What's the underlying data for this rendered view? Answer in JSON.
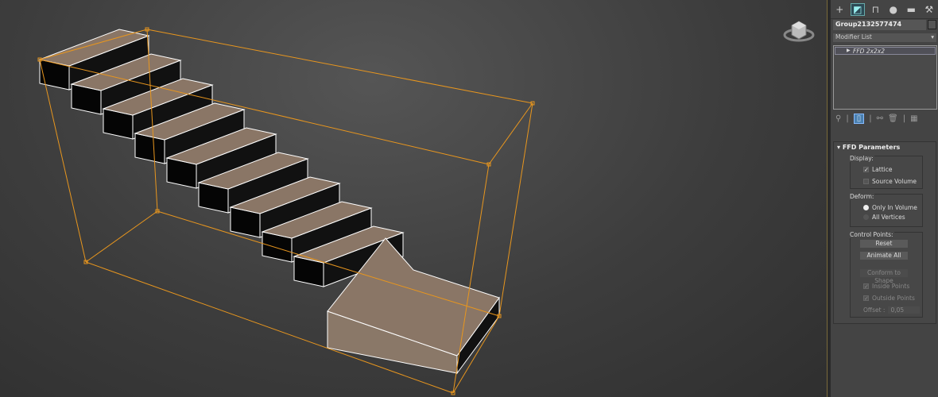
{
  "command_panel": {
    "tabs": [
      {
        "name": "create",
        "glyph": "+"
      },
      {
        "name": "modify",
        "glyph": "◩"
      },
      {
        "name": "hierarchy",
        "glyph": "⊓"
      },
      {
        "name": "motion",
        "glyph": "●"
      },
      {
        "name": "display",
        "glyph": "▬"
      },
      {
        "name": "utilities",
        "glyph": "⚒"
      }
    ],
    "object_name": "Group2132577474",
    "modifier_list": "Modifier List",
    "stack": [
      {
        "label": "FFD 2x2x2"
      }
    ],
    "rollout": {
      "title": "FFD Parameters",
      "display": {
        "label": "Display:",
        "lattice": "Lattice",
        "lattice_checked": true,
        "source_volume": "Source Volume",
        "source_volume_checked": false
      },
      "deform": {
        "label": "Deform:",
        "only_in_volume": "Only In Volume",
        "all_vertices": "All Vertices",
        "selected": "only_in_volume"
      },
      "control_points": {
        "label": "Control Points:",
        "reset": "Reset",
        "animate_all": "Animate All",
        "conform": "Conform to Shape",
        "inside_points": "Inside Points",
        "outside_points": "Outside Points",
        "offset_label": "Offset :",
        "offset_value": "0,05"
      }
    }
  },
  "colors": {
    "lattice": "#e8961e",
    "step_top": "#8a7666",
    "step_front": "#050505",
    "accent": "#4a80b0"
  }
}
